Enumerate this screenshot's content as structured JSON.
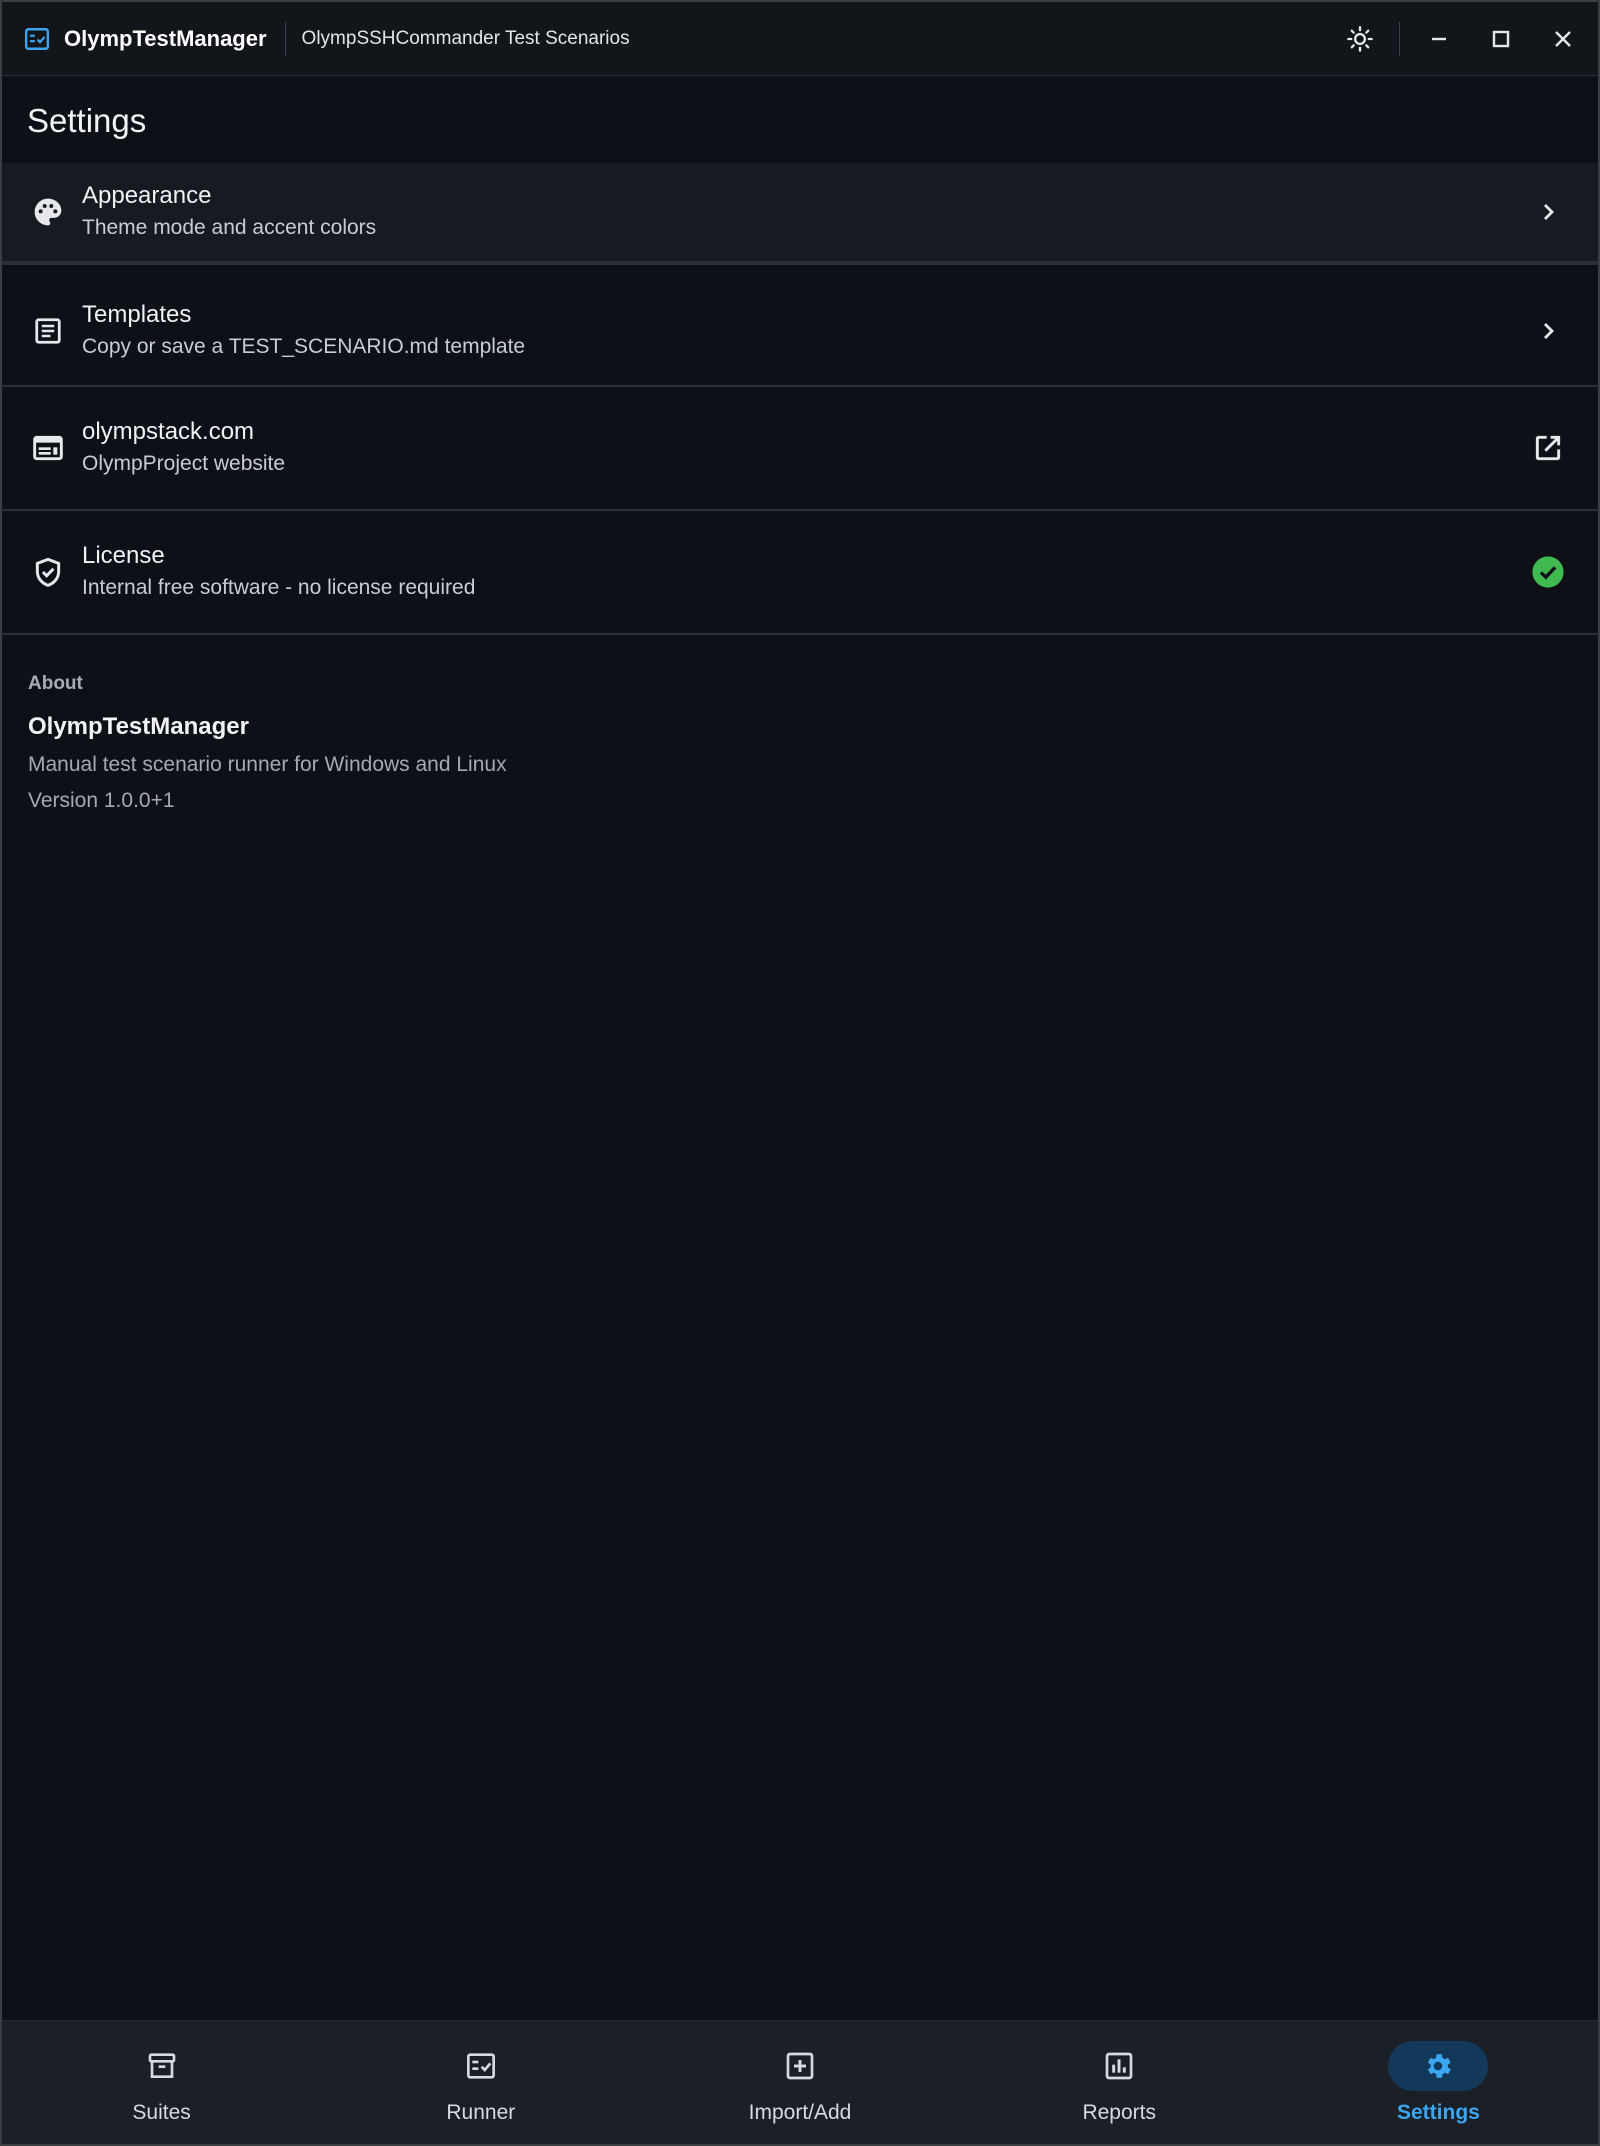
{
  "titlebar": {
    "app_name": "OlympTestManager",
    "project_name": "OlympSSHCommander Test Scenarios",
    "icons": [
      "checklist-logo-icon",
      "brightness-icon",
      "minimize-icon",
      "maximize-icon",
      "close-icon"
    ]
  },
  "page": {
    "title": "Settings"
  },
  "settings": [
    {
      "title": "Appearance",
      "subtitle": "Theme mode and accent colors",
      "icon": "palette-icon",
      "trailing": "chevron-right-icon"
    },
    {
      "title": "Templates",
      "subtitle": "Copy or save a TEST_SCENARIO.md template",
      "icon": "article-icon",
      "trailing": "chevron-right-icon"
    },
    {
      "title": "olympstack.com",
      "subtitle": "OlympProject website",
      "icon": "web-icon",
      "trailing": "open-in-new-icon"
    },
    {
      "title": "License",
      "subtitle": "Internal free software - no license required",
      "icon": "shield-check-icon",
      "trailing": "check-circle-icon"
    }
  ],
  "about": {
    "heading": "About",
    "app_name": "OlympTestManager",
    "description": "Manual test scenario runner for Windows and Linux",
    "version": "Version 1.0.0+1"
  },
  "nav": [
    {
      "label": "Suites",
      "icon": "archive-icon"
    },
    {
      "label": "Runner",
      "icon": "checklist-icon"
    },
    {
      "label": "Import/Add",
      "icon": "add-box-icon"
    },
    {
      "label": "Reports",
      "icon": "bar-chart-icon"
    },
    {
      "label": "Settings",
      "icon": "gear-icon",
      "active": true
    }
  ],
  "colors": {
    "accent": "#3da6f0",
    "success": "#3fb950",
    "background": "#0d1117"
  }
}
